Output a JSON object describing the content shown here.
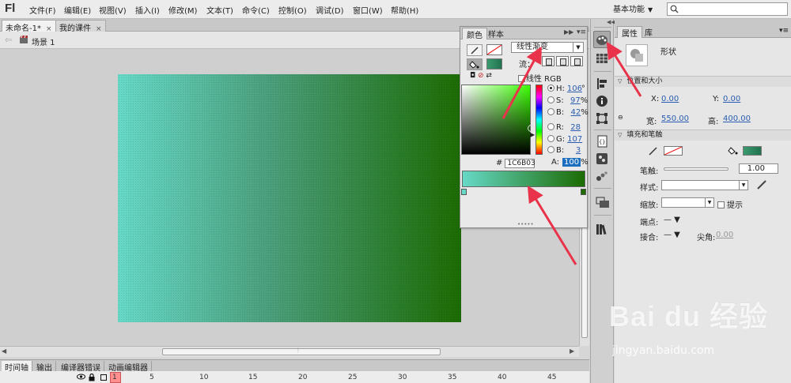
{
  "app": {
    "logo": "Fl"
  },
  "menu": [
    "文件(F)",
    "编辑(E)",
    "视图(V)",
    "插入(I)",
    "修改(M)",
    "文本(T)",
    "命令(C)",
    "控制(O)",
    "调试(D)",
    "窗口(W)",
    "帮助(H)"
  ],
  "workspace": {
    "label": "基本功能"
  },
  "search": {
    "placeholder": ""
  },
  "doc_tabs": [
    {
      "label": "未命名-1*",
      "close": "×"
    },
    {
      "label": "我的课件",
      "close": "×"
    }
  ],
  "scene": {
    "label": "场景 1"
  },
  "timeline": {
    "tabs": [
      "时间轴",
      "输出",
      "编译器错误",
      "动画编辑器"
    ],
    "frame_numbers": [
      "1",
      "5",
      "10",
      "15",
      "20",
      "25",
      "30",
      "35",
      "40",
      "45"
    ]
  },
  "color_panel": {
    "tabs": [
      "颜色",
      "样本"
    ],
    "fill_type": "线性渐变",
    "flow_label": "流：",
    "linear_rgb": "线性 RGB",
    "hsb": [
      {
        "label": "H:",
        "value": "106",
        "unit": "°"
      },
      {
        "label": "S:",
        "value": "97",
        "unit": "%"
      },
      {
        "label": "B:",
        "value": "42",
        "unit": "%"
      }
    ],
    "rgb": [
      {
        "label": "R:",
        "value": "28"
      },
      {
        "label": "G:",
        "value": "107"
      },
      {
        "label": "B:",
        "value": "3"
      }
    ],
    "alpha": {
      "label": "A:",
      "value": "100",
      "unit": "%"
    },
    "hex": {
      "label": "#",
      "value": "1C6B03"
    },
    "gradient_start": "#66d9c7",
    "gradient_end": "#1c6b03"
  },
  "props": {
    "tabs": [
      "属性",
      "库"
    ],
    "shape_type": "形状",
    "pos_size_header": "位置和大小",
    "x_label": "X:",
    "x_value": "0.00",
    "y_label": "Y:",
    "y_value": "0.00",
    "w_label": "宽:",
    "w_value": "550.00",
    "h_label": "高:",
    "h_value": "400.00",
    "fill_stroke_header": "填充和笔触",
    "stroke_label": "笔触:",
    "stroke_width": "1.00",
    "style_label": "样式:",
    "scale_label": "缩放:",
    "hint_label": "提示",
    "cap_label": "端点:",
    "join_label": "接合:",
    "miter_label": "尖角:",
    "miter_value": "0.00"
  },
  "watermark": {
    "logo": "Bai du 经验",
    "url": "jingyan.baidu.com"
  },
  "accent_color": "#e8334a"
}
